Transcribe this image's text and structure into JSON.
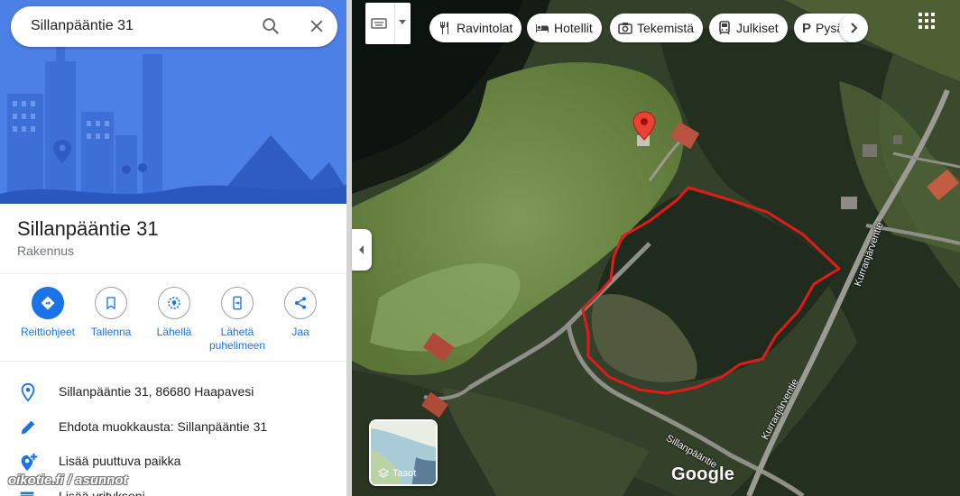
{
  "search": {
    "query": "Sillanpääntie 31"
  },
  "place": {
    "title": "Sillanpääntie 31",
    "subtitle": "Rakennus"
  },
  "actions": [
    {
      "label": "Reittiohjeet",
      "icon": "directions-icon"
    },
    {
      "label": "Tallenna",
      "icon": "bookmark-icon"
    },
    {
      "label": "Lähellä",
      "icon": "nearby-icon"
    },
    {
      "label": "Lähetä puhelimeen",
      "icon": "send-to-phone-icon"
    },
    {
      "label": "Jaa",
      "icon": "share-icon"
    }
  ],
  "info": [
    {
      "text": "Sillanpääntie 31, 86680 Haapavesi",
      "icon": "location-pin-icon"
    },
    {
      "text": "Ehdota muokkausta: Sillanpääntie 31",
      "icon": "pencil-icon"
    },
    {
      "text": "Lisää puuttuva paikka",
      "icon": "add-place-icon"
    },
    {
      "text": "Lisää yritykseni",
      "icon": "add-business-icon"
    }
  ],
  "watermark": "oikotie.fi / asunnot",
  "map": {
    "chips": [
      {
        "label": "Ravintolat",
        "icon": "restaurant-icon"
      },
      {
        "label": "Hotellit",
        "icon": "hotel-icon"
      },
      {
        "label": "Tekemistä",
        "icon": "camera-icon"
      },
      {
        "label": "Julkiset",
        "icon": "transit-icon"
      },
      {
        "label": "Pysäköinti",
        "icon": "parking-icon"
      }
    ],
    "layers_label": "Tasot",
    "logo": "Google",
    "road_labels": [
      "Kurranjärventie",
      "Kurranjärventie",
      "Sillanpääntie"
    ],
    "colors": {
      "boundary": "#e01b1b",
      "pin": "#ea4335",
      "accent": "#1a73e8"
    }
  }
}
